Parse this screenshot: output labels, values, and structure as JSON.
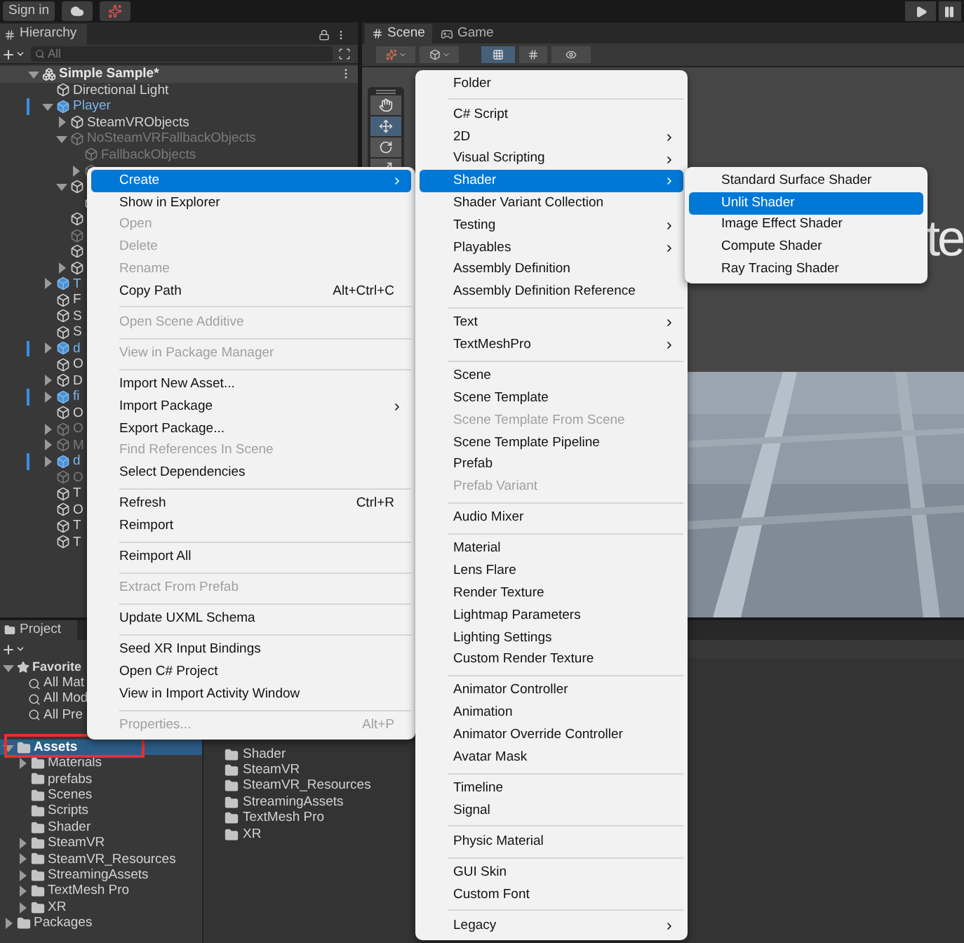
{
  "toolbar": {
    "sign_in": "Sign in"
  },
  "hierarchy": {
    "title": "Hierarchy",
    "search": {
      "placeholder": "All"
    },
    "tree": [
      {
        "label": "Simple Sample*",
        "kind": "scene",
        "expanded": true,
        "children": [
          {
            "label": "Directional Light",
            "kind": "object",
            "prefab": false,
            "inactive": false,
            "override": false
          },
          {
            "label": "Player",
            "kind": "object",
            "expanded": true,
            "prefab": true,
            "inactive": false,
            "override": true,
            "children": [
              {
                "label": "SteamVRObjects",
                "kind": "object",
                "expanded": false,
                "prefab": false,
                "inactive": false,
                "override": false
              },
              {
                "label": "NoSteamVRFallbackObjects",
                "kind": "object",
                "expanded": true,
                "prefab": false,
                "inactive": true,
                "override": false,
                "children": [
                  {
                    "label": "FallbackObjects",
                    "kind": "object",
                    "prefab": false,
                    "inactive": true,
                    "override": false
                  },
                  {
                    "kind": "object",
                    "expanded": false,
                    "prefab": false,
                    "inactive": true,
                    "override": false
                  }
                ]
              },
              {
                "kind": "object",
                "expanded": true,
                "prefab": false,
                "inactive": false,
                "override": false,
                "children": [
                  {
                    "kind": "object",
                    "prefab": false,
                    "inactive": false,
                    "override": false
                  }
                ]
              },
              {
                "kind": "object",
                "prefab": false,
                "inactive": false,
                "override": false
              },
              {
                "kind": "object",
                "prefab": false,
                "inactive": true,
                "override": false
              },
              {
                "kind": "object",
                "prefab": false,
                "inactive": false,
                "override": false
              },
              {
                "kind": "object",
                "expanded": false,
                "prefab": false,
                "inactive": false,
                "override": false
              }
            ]
          },
          {
            "label": "T",
            "kind": "object",
            "expanded": false,
            "prefab": true,
            "inactive": false,
            "override": false
          },
          {
            "label": "F",
            "kind": "object",
            "prefab": false,
            "inactive": false,
            "override": false
          },
          {
            "label": "S",
            "kind": "object",
            "prefab": false,
            "inactive": false,
            "override": false
          },
          {
            "label": "S",
            "kind": "object",
            "prefab": false,
            "inactive": false,
            "override": false
          },
          {
            "label": "d",
            "kind": "object",
            "expanded": false,
            "prefab": true,
            "inactive": false,
            "override": true
          },
          {
            "label": "O",
            "kind": "object",
            "prefab": false,
            "inactive": false,
            "override": false
          },
          {
            "label": "D",
            "kind": "object",
            "expanded": false,
            "prefab": false,
            "inactive": false,
            "override": false
          },
          {
            "label": "fi",
            "kind": "object",
            "expanded": false,
            "prefab": true,
            "inactive": false,
            "override": true
          },
          {
            "label": "O",
            "kind": "object",
            "prefab": false,
            "inactive": false,
            "override": false
          },
          {
            "label": "O",
            "kind": "object",
            "expanded": false,
            "prefab": false,
            "inactive": true,
            "override": false
          },
          {
            "label": "M",
            "kind": "object",
            "expanded": false,
            "prefab": false,
            "inactive": true,
            "override": false
          },
          {
            "label": "d",
            "kind": "object",
            "expanded": false,
            "prefab": true,
            "inactive": false,
            "override": true
          },
          {
            "label": "O",
            "kind": "object",
            "prefab": false,
            "inactive": true,
            "override": false
          },
          {
            "label": "T",
            "kind": "object",
            "prefab": false,
            "inactive": false,
            "override": false
          },
          {
            "label": "O",
            "kind": "object",
            "prefab": false,
            "inactive": false,
            "override": false
          },
          {
            "label": "T",
            "kind": "object",
            "prefab": false,
            "inactive": false,
            "override": false
          },
          {
            "label": "T",
            "kind": "object",
            "prefab": false,
            "inactive": false,
            "override": false
          }
        ]
      }
    ]
  },
  "scene_panel": {
    "tabs": [
      {
        "label": "Scene",
        "kind": "scene",
        "selected": true
      },
      {
        "label": "Game",
        "kind": "game",
        "selected": false
      }
    ],
    "scene_text": "te"
  },
  "project": {
    "title": "Project",
    "favorites": {
      "label": "Favorite",
      "expanded": true,
      "searches": [
        "All Mat",
        "All Mod",
        "All Pre"
      ]
    },
    "tree": [
      {
        "label": "Assets",
        "expanded": true,
        "selected": true,
        "children": [
          {
            "label": "Materials",
            "expanded": false,
            "selected": false
          },
          {
            "label": "prefabs",
            "selected": false
          },
          {
            "label": "Scenes",
            "selected": false
          },
          {
            "label": "Scripts",
            "selected": false
          },
          {
            "label": "Shader",
            "selected": false
          },
          {
            "label": "SteamVR",
            "expanded": false,
            "selected": false
          },
          {
            "label": "SteamVR_Resources",
            "expanded": false,
            "selected": false
          },
          {
            "label": "StreamingAssets",
            "expanded": false,
            "selected": false
          },
          {
            "label": "TextMesh Pro",
            "expanded": false,
            "selected": false
          },
          {
            "label": "XR",
            "expanded": false,
            "selected": false
          }
        ]
      },
      {
        "label": "Packages",
        "expanded": false,
        "selected": false
      }
    ],
    "folders": [
      "Shader",
      "SteamVR",
      "SteamVR_Resources",
      "StreamingAssets",
      "TextMesh Pro",
      "XR"
    ]
  },
  "context_menu": {
    "items": [
      {
        "kind": "item",
        "label": "Create",
        "selected": true,
        "disabled": false,
        "submenu": true
      },
      {
        "kind": "item",
        "label": "Show in Explorer",
        "selected": false,
        "disabled": false,
        "submenu": false
      },
      {
        "kind": "item",
        "label": "Open",
        "selected": false,
        "disabled": true,
        "submenu": false
      },
      {
        "kind": "item",
        "label": "Delete",
        "selected": false,
        "disabled": true,
        "submenu": false
      },
      {
        "kind": "item",
        "label": "Rename",
        "selected": false,
        "disabled": true,
        "submenu": false
      },
      {
        "kind": "item",
        "label": "Copy Path",
        "shortcut": "Alt+Ctrl+C",
        "selected": false,
        "disabled": false,
        "submenu": false
      },
      {
        "kind": "separator"
      },
      {
        "kind": "item",
        "label": "Open Scene Additive",
        "selected": false,
        "disabled": true,
        "submenu": false
      },
      {
        "kind": "separator"
      },
      {
        "kind": "item",
        "label": "View in Package Manager",
        "selected": false,
        "disabled": true,
        "submenu": false
      },
      {
        "kind": "separator"
      },
      {
        "kind": "item",
        "label": "Import New Asset...",
        "selected": false,
        "disabled": false,
        "submenu": false
      },
      {
        "kind": "item",
        "label": "Import Package",
        "selected": false,
        "disabled": false,
        "submenu": true
      },
      {
        "kind": "item",
        "label": "Export Package...",
        "selected": false,
        "disabled": false,
        "submenu": false
      },
      {
        "kind": "item",
        "label": "Find References In Scene",
        "selected": false,
        "disabled": true,
        "submenu": false
      },
      {
        "kind": "item",
        "label": "Select Dependencies",
        "selected": false,
        "disabled": false,
        "submenu": false
      },
      {
        "kind": "separator"
      },
      {
        "kind": "item",
        "label": "Refresh",
        "shortcut": "Ctrl+R",
        "selected": false,
        "disabled": false,
        "submenu": false
      },
      {
        "kind": "item",
        "label": "Reimport",
        "selected": false,
        "disabled": false,
        "submenu": false
      },
      {
        "kind": "separator"
      },
      {
        "kind": "item",
        "label": "Reimport All",
        "selected": false,
        "disabled": false,
        "submenu": false
      },
      {
        "kind": "separator"
      },
      {
        "kind": "item",
        "label": "Extract From Prefab",
        "selected": false,
        "disabled": true,
        "submenu": false
      },
      {
        "kind": "separator"
      },
      {
        "kind": "item",
        "label": "Update UXML Schema",
        "selected": false,
        "disabled": false,
        "submenu": false
      },
      {
        "kind": "separator"
      },
      {
        "kind": "item",
        "label": "Seed XR Input Bindings",
        "selected": false,
        "disabled": false,
        "submenu": false
      },
      {
        "kind": "item",
        "label": "Open C# Project",
        "selected": false,
        "disabled": false,
        "submenu": false
      },
      {
        "kind": "item",
        "label": "View in Import Activity Window",
        "selected": false,
        "disabled": false,
        "submenu": false
      },
      {
        "kind": "separator"
      },
      {
        "kind": "item",
        "label": "Properties...",
        "shortcut": "Alt+P",
        "selected": false,
        "disabled": true,
        "submenu": false
      }
    ]
  },
  "create_submenu": {
    "items": [
      {
        "kind": "item",
        "label": "Folder",
        "selected": false,
        "disabled": false,
        "submenu": false
      },
      {
        "kind": "separator"
      },
      {
        "kind": "item",
        "label": "C# Script",
        "selected": false,
        "disabled": false,
        "submenu": false
      },
      {
        "kind": "item",
        "label": "2D",
        "selected": false,
        "disabled": false,
        "submenu": true
      },
      {
        "kind": "item",
        "label": "Visual Scripting",
        "selected": false,
        "disabled": false,
        "submenu": true
      },
      {
        "kind": "item",
        "label": "Shader",
        "selected": true,
        "disabled": false,
        "submenu": true
      },
      {
        "kind": "item",
        "label": "Shader Variant Collection",
        "selected": false,
        "disabled": false,
        "submenu": false
      },
      {
        "kind": "item",
        "label": "Testing",
        "selected": false,
        "disabled": false,
        "submenu": true
      },
      {
        "kind": "item",
        "label": "Playables",
        "selected": false,
        "disabled": false,
        "submenu": true
      },
      {
        "kind": "item",
        "label": "Assembly Definition",
        "selected": false,
        "disabled": false,
        "submenu": false
      },
      {
        "kind": "item",
        "label": "Assembly Definition Reference",
        "selected": false,
        "disabled": false,
        "submenu": false
      },
      {
        "kind": "separator"
      },
      {
        "kind": "item",
        "label": "Text",
        "selected": false,
        "disabled": false,
        "submenu": true
      },
      {
        "kind": "item",
        "label": "TextMeshPro",
        "selected": false,
        "disabled": false,
        "submenu": true
      },
      {
        "kind": "separator"
      },
      {
        "kind": "item",
        "label": "Scene",
        "selected": false,
        "disabled": false,
        "submenu": false
      },
      {
        "kind": "item",
        "label": "Scene Template",
        "selected": false,
        "disabled": false,
        "submenu": false
      },
      {
        "kind": "item",
        "label": "Scene Template From Scene",
        "selected": false,
        "disabled": true,
        "submenu": false
      },
      {
        "kind": "item",
        "label": "Scene Template Pipeline",
        "selected": false,
        "disabled": false,
        "submenu": false
      },
      {
        "kind": "item",
        "label": "Prefab",
        "selected": false,
        "disabled": false,
        "submenu": false
      },
      {
        "kind": "item",
        "label": "Prefab Variant",
        "selected": false,
        "disabled": true,
        "submenu": false
      },
      {
        "kind": "separator"
      },
      {
        "kind": "item",
        "label": "Audio Mixer",
        "selected": false,
        "disabled": false,
        "submenu": false
      },
      {
        "kind": "separator"
      },
      {
        "kind": "item",
        "label": "Material",
        "selected": false,
        "disabled": false,
        "submenu": false
      },
      {
        "kind": "item",
        "label": "Lens Flare",
        "selected": false,
        "disabled": false,
        "submenu": false
      },
      {
        "kind": "item",
        "label": "Render Texture",
        "selected": false,
        "disabled": false,
        "submenu": false
      },
      {
        "kind": "item",
        "label": "Lightmap Parameters",
        "selected": false,
        "disabled": false,
        "submenu": false
      },
      {
        "kind": "item",
        "label": "Lighting Settings",
        "selected": false,
        "disabled": false,
        "submenu": false
      },
      {
        "kind": "item",
        "label": "Custom Render Texture",
        "selected": false,
        "disabled": false,
        "submenu": false
      },
      {
        "kind": "separator"
      },
      {
        "kind": "item",
        "label": "Animator Controller",
        "selected": false,
        "disabled": false,
        "submenu": false
      },
      {
        "kind": "item",
        "label": "Animation",
        "selected": false,
        "disabled": false,
        "submenu": false
      },
      {
        "kind": "item",
        "label": "Animator Override Controller",
        "selected": false,
        "disabled": false,
        "submenu": false
      },
      {
        "kind": "item",
        "label": "Avatar Mask",
        "selected": false,
        "disabled": false,
        "submenu": false
      },
      {
        "kind": "separator"
      },
      {
        "kind": "item",
        "label": "Timeline",
        "selected": false,
        "disabled": false,
        "submenu": false
      },
      {
        "kind": "item",
        "label": "Signal",
        "selected": false,
        "disabled": false,
        "submenu": false
      },
      {
        "kind": "separator"
      },
      {
        "kind": "item",
        "label": "Physic Material",
        "selected": false,
        "disabled": false,
        "submenu": false
      },
      {
        "kind": "separator"
      },
      {
        "kind": "item",
        "label": "GUI Skin",
        "selected": false,
        "disabled": false,
        "submenu": false
      },
      {
        "kind": "item",
        "label": "Custom Font",
        "selected": false,
        "disabled": false,
        "submenu": false
      },
      {
        "kind": "separator"
      },
      {
        "kind": "item",
        "label": "Legacy",
        "selected": false,
        "disabled": false,
        "submenu": true
      }
    ]
  },
  "shader_submenu": {
    "items": [
      {
        "kind": "item",
        "label": "Standard Surface Shader",
        "selected": false,
        "disabled": false,
        "submenu": false
      },
      {
        "kind": "item",
        "label": "Unlit Shader",
        "selected": true,
        "disabled": false,
        "submenu": false
      },
      {
        "kind": "item",
        "label": "Image Effect Shader",
        "selected": false,
        "disabled": false,
        "submenu": false
      },
      {
        "kind": "item",
        "label": "Compute Shader",
        "selected": false,
        "disabled": false,
        "submenu": false
      },
      {
        "kind": "item",
        "label": "Ray Tracing Shader",
        "selected": false,
        "disabled": false,
        "submenu": false
      }
    ]
  }
}
